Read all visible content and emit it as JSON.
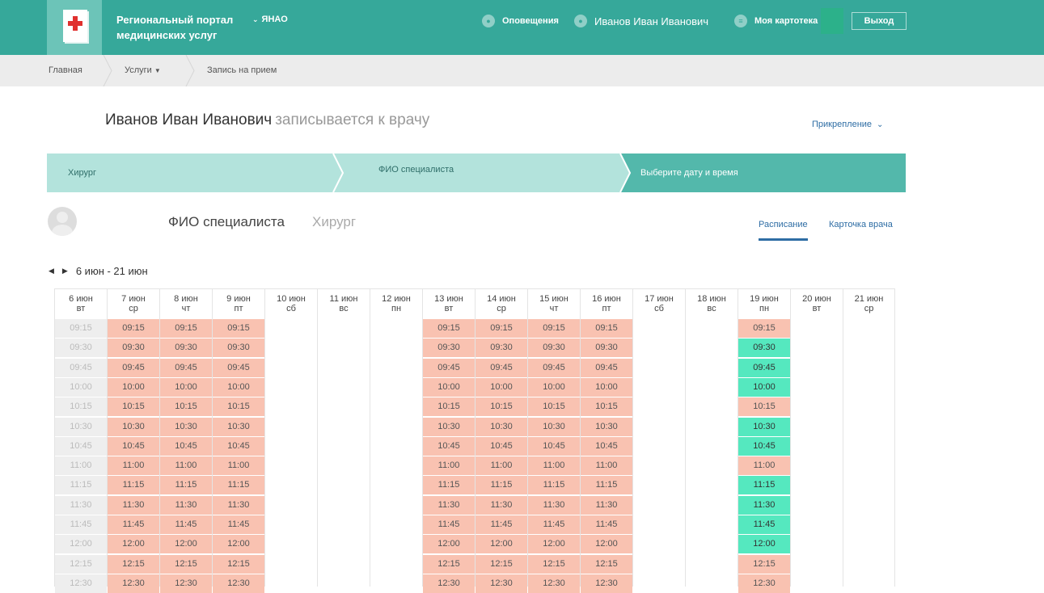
{
  "header": {
    "portal_title": "Региональный портал медицинских услуг",
    "region": "ЯНАО",
    "notifications": "Оповещения",
    "user_name": "Иванов Иван Иванович",
    "my_card": "Моя картотека",
    "logout": "Выход"
  },
  "breadcrumbs": {
    "home": "Главная",
    "services": "Услуги",
    "current": "Запись на прием"
  },
  "page": {
    "patient": "Иванов Иван Иванович",
    "action": "записывается к врачу",
    "attach": "Прикрепление"
  },
  "steps": [
    "Хирург",
    "ФИО специалиста",
    "Выберите дату и время"
  ],
  "doctor": {
    "name": "ФИО специалиста",
    "specialty": "Хирург",
    "tab_schedule": "Расписание",
    "tab_card": "Карточка врача"
  },
  "date_range": "6 июн - 21 июн",
  "colors": {
    "brand": "#36a89a",
    "busy": "#f9c2b1",
    "free": "#55e8bf",
    "link": "#2e6da4"
  },
  "times": [
    "09:15",
    "09:30",
    "09:45",
    "10:00",
    "10:15",
    "10:30",
    "10:45",
    "11:00",
    "11:15",
    "11:30",
    "11:45",
    "12:00",
    "12:15",
    "12:30"
  ],
  "days": [
    {
      "date": "6 июн",
      "dow": "вт",
      "state": "past"
    },
    {
      "date": "7 июн",
      "dow": "ср",
      "state": "busy"
    },
    {
      "date": "8 июн",
      "dow": "чт",
      "state": "busy"
    },
    {
      "date": "9 июн",
      "dow": "пт",
      "state": "busy"
    },
    {
      "date": "10 июн",
      "dow": "сб",
      "state": "none"
    },
    {
      "date": "11 июн",
      "dow": "вс",
      "state": "none"
    },
    {
      "date": "12 июн",
      "dow": "пн",
      "state": "none"
    },
    {
      "date": "13 июн",
      "dow": "вт",
      "state": "busy"
    },
    {
      "date": "14 июн",
      "dow": "ср",
      "state": "busy"
    },
    {
      "date": "15 июн",
      "dow": "чт",
      "state": "busy"
    },
    {
      "date": "16 июн",
      "dow": "пт",
      "state": "busy"
    },
    {
      "date": "17 июн",
      "dow": "сб",
      "state": "none"
    },
    {
      "date": "18 июн",
      "dow": "вс",
      "state": "none"
    },
    {
      "date": "19 июн",
      "dow": "пн",
      "state": "mixed",
      "free": [
        "09:30",
        "09:45",
        "10:00",
        "10:30",
        "10:45",
        "11:15",
        "11:30",
        "11:45",
        "12:00"
      ]
    },
    {
      "date": "20 июн",
      "dow": "вт",
      "state": "none"
    },
    {
      "date": "21 июн",
      "dow": "ср",
      "state": "none"
    }
  ]
}
